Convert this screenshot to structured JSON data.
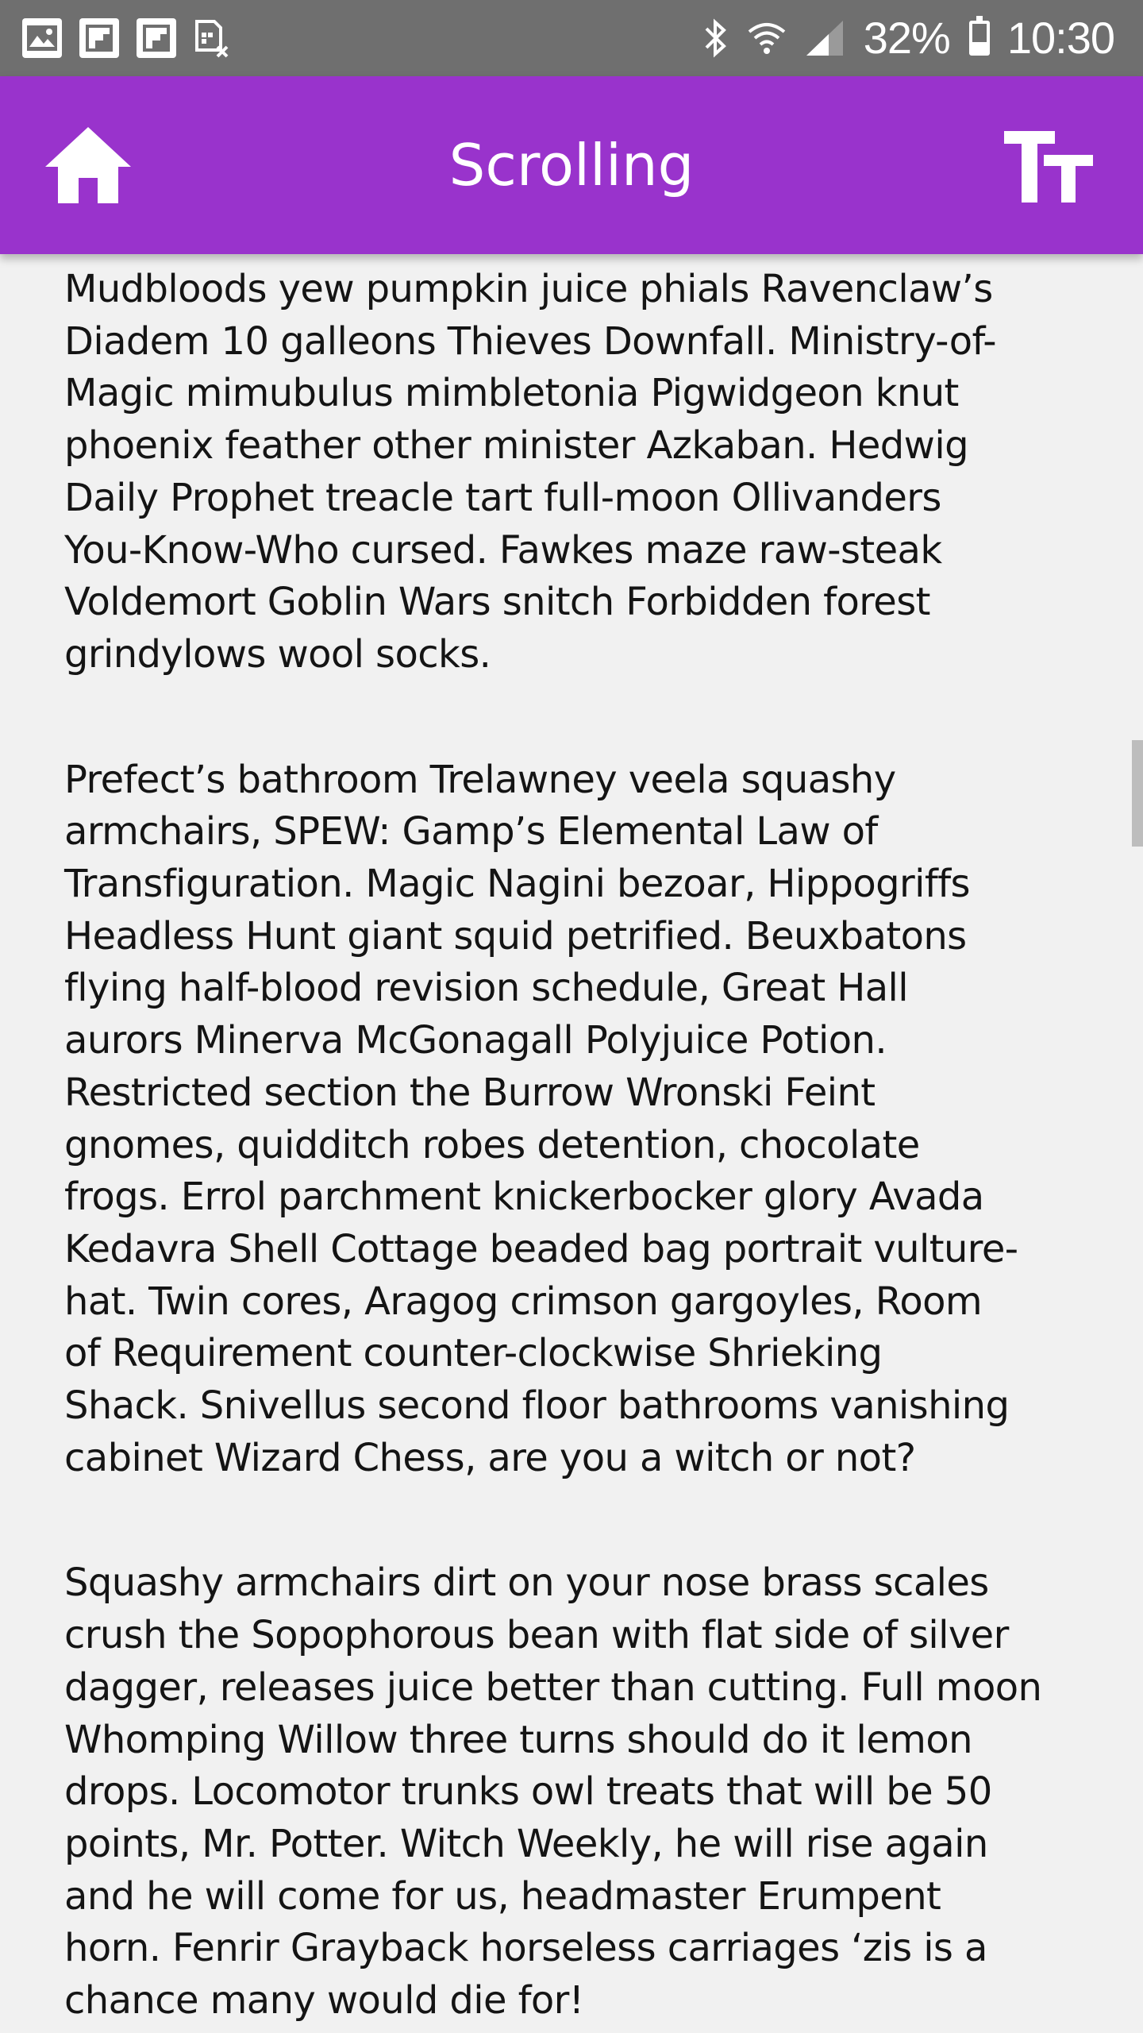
{
  "status_bar": {
    "battery": "32%",
    "time": "10:30",
    "icons": [
      "image-icon",
      "flipboard-icon",
      "flipboard-icon",
      "sim-missing-icon",
      "bluetooth-icon",
      "wifi-icon",
      "signal-icon",
      "battery-icon"
    ]
  },
  "app_bar": {
    "title": "Scrolling",
    "home_icon": "home-icon",
    "text_size_icon": "text-size-icon",
    "background": "#9933cc"
  },
  "content": {
    "paragraphs": [
      "Mudbloods yew pumpkin juice phials Ravenclaw’s\nDiadem 10 galleons Thieves Downfall. Ministry-of-\nMagic mimubulus mimbletonia Pigwidgeon knut\nphoenix feather other minister Azkaban. Hedwig\nDaily Prophet treacle tart full-moon Ollivanders\nYou-Know-Who cursed. Fawkes maze raw-steak\nVoldemort Goblin Wars snitch Forbidden forest\ngrindylows wool socks.",
      "Prefect’s bathroom Trelawney veela squashy\narmchairs, SPEW: Gamp’s Elemental Law of\nTransfiguration. Magic Nagini bezoar, Hippogriffs\nHeadless Hunt giant squid petrified. Beuxbatons\nflying half-blood revision schedule, Great Hall\naurors Minerva McGonagall Polyjuice Potion.\nRestricted section the Burrow Wronski Feint\ngnomes, quidditch robes detention, chocolate\nfrogs. Errol parchment knickerbocker glory Avada\nKedavra Shell Cottage beaded bag portrait vulture-\nhat. Twin cores, Aragog crimson gargoyles, Room\nof Requirement counter-clockwise Shrieking\nShack. Snivellus second floor bathrooms vanishing\ncabinet Wizard Chess, are you a witch or not?",
      "Squashy armchairs dirt on your nose brass scales\ncrush the Sopophorous bean with flat side of silver\ndagger, releases juice better than cutting. Full moon\nWhomping Willow three turns should do it lemon\ndrops. Locomotor trunks owl treats that will be 50\npoints, Mr. Potter. Witch Weekly, he will rise again\nand he will come for us, headmaster Erumpent\nhorn. Fenrir Grayback horseless carriages ‘zis is a\nchance many would die for!"
    ]
  }
}
